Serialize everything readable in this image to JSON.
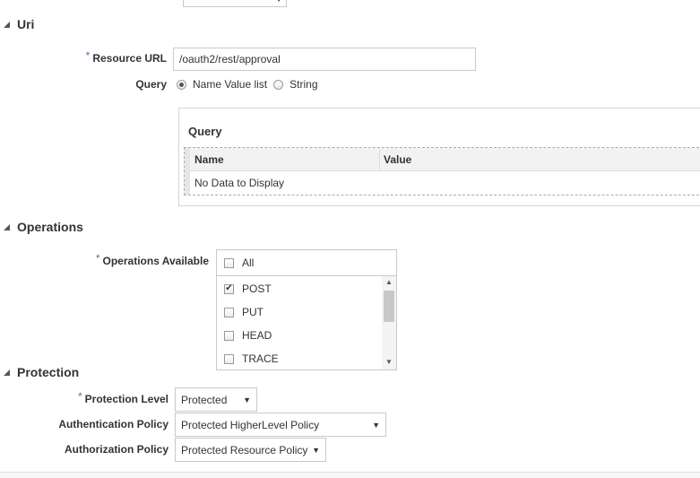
{
  "uri": {
    "section_title": "Uri",
    "resource_url_label": "Resource URL",
    "resource_url_value": "/oauth2/rest/approval",
    "query_label": "Query",
    "query_options": [
      "Name Value list",
      "String"
    ],
    "query_table": {
      "title": "Query",
      "columns": [
        "Name",
        "Value"
      ],
      "empty_text": "No Data to Display"
    }
  },
  "operations": {
    "section_title": "Operations",
    "available_label": "Operations Available",
    "all_label": "All",
    "items": [
      {
        "label": "POST",
        "checked": true
      },
      {
        "label": "PUT",
        "checked": false
      },
      {
        "label": "HEAD",
        "checked": false
      },
      {
        "label": "TRACE",
        "checked": false
      }
    ]
  },
  "protection": {
    "section_title": "Protection",
    "level_label": "Protection Level",
    "level_value": "Protected",
    "authn_label": "Authentication Policy",
    "authn_value": "Protected HigherLevel Policy",
    "authz_label": "Authorization Policy",
    "authz_value": "Protected Resource Policy"
  },
  "icons": {
    "collapse": "triangle-expanded-icon",
    "dropdown": "chevron-down-icon",
    "checkmark": "✔"
  },
  "colors": {
    "required_star": "#3b79b7",
    "border": "#c9c9c9"
  }
}
